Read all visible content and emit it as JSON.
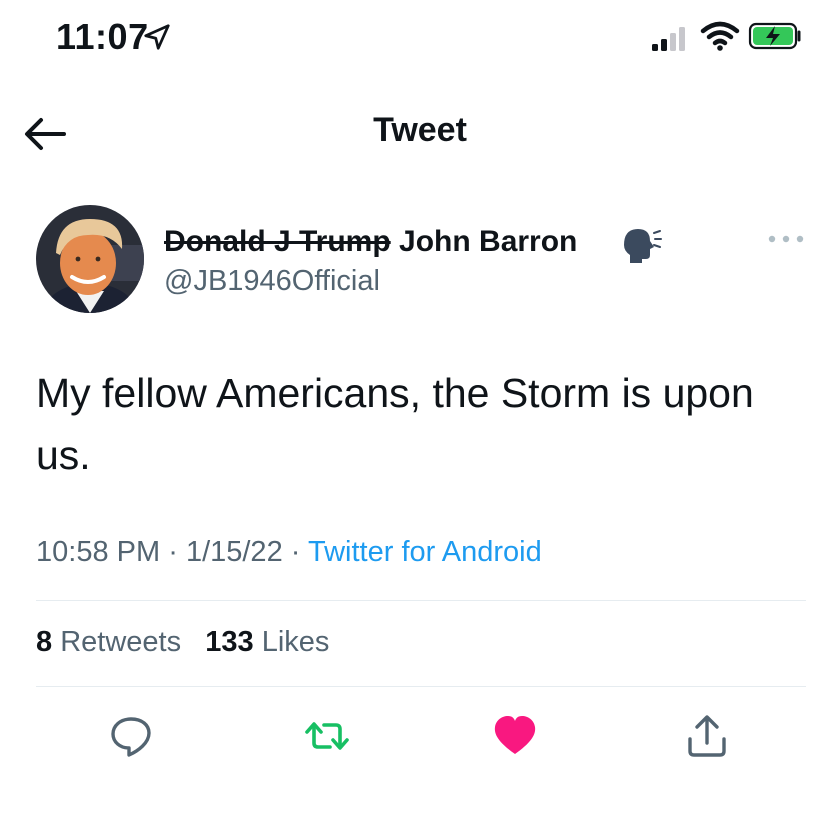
{
  "status_bar": {
    "time": "11:07",
    "icons": [
      "location-arrow-icon",
      "signal-icon",
      "wifi-icon",
      "battery-charging-icon"
    ]
  },
  "nav": {
    "title": "Tweet",
    "back_icon": "back-arrow-icon"
  },
  "tweet": {
    "author_struck": "Donald J Trump",
    "author_name": "John Barron",
    "handle": "@JB1946Official",
    "badge_icon": "speaking-head-icon",
    "more_icon": "more-dots-icon",
    "text": "My fellow Americans, the Storm is upon us.",
    "time": "10:58 PM",
    "date": "1/15/22",
    "sep": "·",
    "source": "Twitter for Android",
    "retweets_count": "8",
    "retweets_label": "Retweets",
    "likes_count": "133",
    "likes_label": "Likes"
  },
  "actions": [
    {
      "icon": "reply-icon"
    },
    {
      "icon": "retweet-icon",
      "color": "#17bf63"
    },
    {
      "icon": "like-heart-icon",
      "color": "#f91880"
    },
    {
      "icon": "share-icon"
    }
  ],
  "colors": {
    "text": "#0f1419",
    "secondary": "#536471",
    "link": "#1d9bf0",
    "retweet": "#17bf63",
    "like": "#f91880",
    "battery": "#34c759"
  }
}
